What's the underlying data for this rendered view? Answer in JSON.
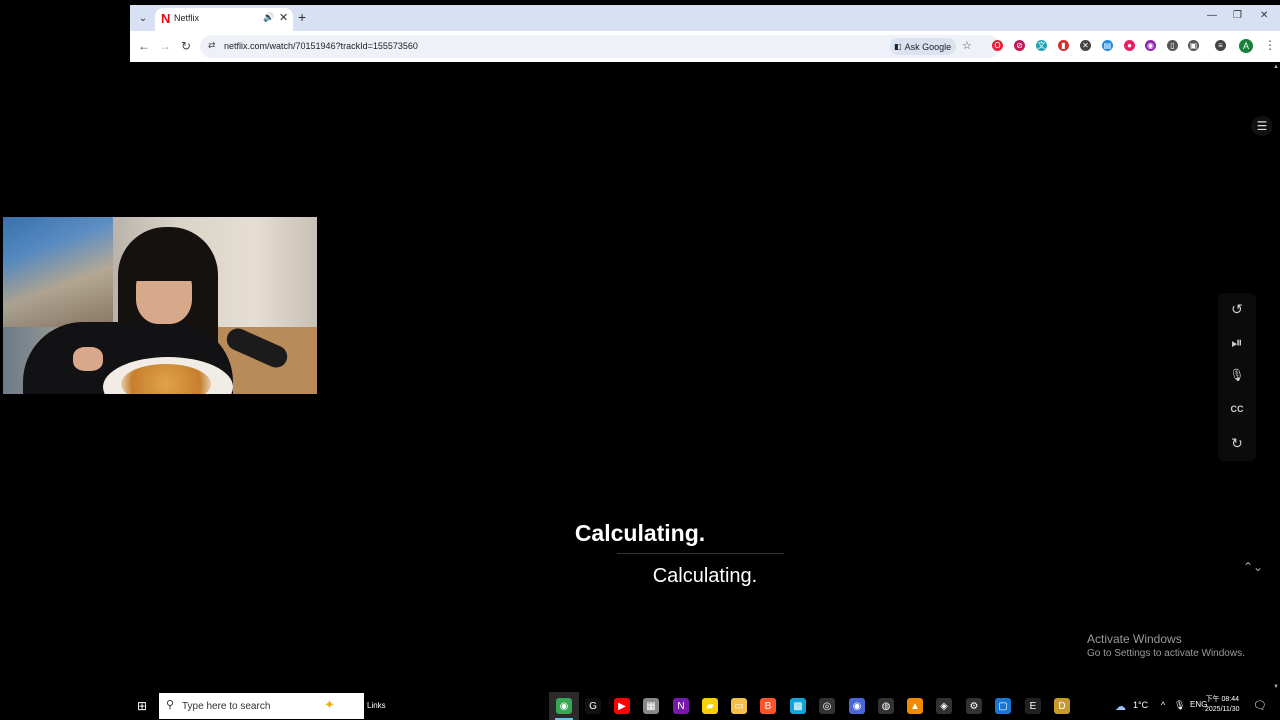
{
  "browser": {
    "tab": {
      "title": "Netflix",
      "favicon": "N"
    },
    "url": "netflix.com/watch/70151946?trackId=155573560",
    "ask_google": "Ask Google",
    "profile_initial": "A",
    "icons": {
      "tab_dropdown": "⌄",
      "tab_audio": "🔊",
      "tab_close": "✕",
      "new_tab": "+",
      "minimize": "—",
      "restore": "❐",
      "close": "✕",
      "back": "←",
      "forward": "→",
      "reload": "↻",
      "site_info": "⇄",
      "star": "☆",
      "menu": "⋮"
    },
    "extensions": [
      {
        "name": "opera-extension-icon",
        "glyph": "O",
        "color": "#e0243a"
      },
      {
        "name": "block-extension-icon",
        "glyph": "⊘",
        "color": "#c2185b"
      },
      {
        "name": "translate-extension-icon",
        "glyph": "文",
        "color": "#1fa3b5"
      },
      {
        "name": "red-extension-icon",
        "glyph": "▮",
        "color": "#d32f2f"
      },
      {
        "name": "tools-extension-icon",
        "glyph": "✕",
        "color": "#444444"
      },
      {
        "name": "doc-extension-icon",
        "glyph": "▤",
        "color": "#1e88e5"
      },
      {
        "name": "adblock-extension-icon",
        "glyph": "●",
        "color": "#e91e63"
      },
      {
        "name": "purple-extension-icon",
        "glyph": "◉",
        "color": "#8e24aa"
      },
      {
        "name": "mouse-extension-icon",
        "glyph": "▯",
        "color": "#555555"
      },
      {
        "name": "puzzle-extension-icon",
        "glyph": "▣",
        "color": "#555555"
      },
      {
        "name": "reading-list-icon",
        "glyph": "≡",
        "color": "#444444"
      }
    ]
  },
  "player": {
    "caption_primary": "Calculating.",
    "caption_secondary": "Calculating.",
    "icons": {
      "menu": "☰",
      "rewind": "↺",
      "play_pause": "⏯",
      "mic": "🎙",
      "subtitles": "CC",
      "forward": "↻",
      "expand": "⌃⌄",
      "scroll_up": "▲",
      "scroll_down": "▼"
    }
  },
  "watermark": {
    "line1": "Activate Windows",
    "line2": "Go to Settings to activate Windows."
  },
  "taskbar": {
    "start_icon": "⊞",
    "search_icon": "⚲",
    "search_placeholder": "Type here to search",
    "search_deco": "✦",
    "links_label": "Links",
    "apps": [
      {
        "name": "chrome-icon",
        "glyph": "◉",
        "color": "#34a853"
      },
      {
        "name": "arc-icon",
        "glyph": "G",
        "color": "#111111"
      },
      {
        "name": "youtube-icon",
        "glyph": "▶",
        "color": "#ff0000"
      },
      {
        "name": "app-generic-icon",
        "glyph": "▦",
        "color": "#888888"
      },
      {
        "name": "onenote-icon",
        "glyph": "N",
        "color": "#7719aa"
      },
      {
        "name": "sticky-notes-icon",
        "glyph": "▰",
        "color": "#f7d000"
      },
      {
        "name": "file-explorer-icon",
        "glyph": "▭",
        "color": "#f4c04b"
      },
      {
        "name": "brave-icon",
        "glyph": "B",
        "color": "#fb542b"
      },
      {
        "name": "store-icon",
        "glyph": "▩",
        "color": "#0fa3d8"
      },
      {
        "name": "screen-recorder-icon",
        "glyph": "◎",
        "color": "#333333"
      },
      {
        "name": "chrome-profile-icon",
        "glyph": "◉",
        "color": "#4a67d6"
      },
      {
        "name": "obs-icon",
        "glyph": "◍",
        "color": "#333333"
      },
      {
        "name": "vlc-icon",
        "glyph": "▲",
        "color": "#f08a00"
      },
      {
        "name": "davinci-icon",
        "glyph": "◈",
        "color": "#333333"
      },
      {
        "name": "settings-icon",
        "glyph": "⚙",
        "color": "#333333"
      },
      {
        "name": "window-app-icon",
        "glyph": "▢",
        "color": "#1976d2"
      },
      {
        "name": "epic-games-icon",
        "glyph": "E",
        "color": "#222222"
      },
      {
        "name": "d-app-icon",
        "glyph": "D",
        "color": "#c79a2c"
      }
    ],
    "tray": {
      "weather_icon": "☁",
      "weather": "1°C",
      "chevron": "^",
      "mic_icon": "🎙",
      "lang": "ENG",
      "time": "下午 08:44",
      "date": "2025/11/30",
      "notification_icon": "🗨"
    }
  }
}
